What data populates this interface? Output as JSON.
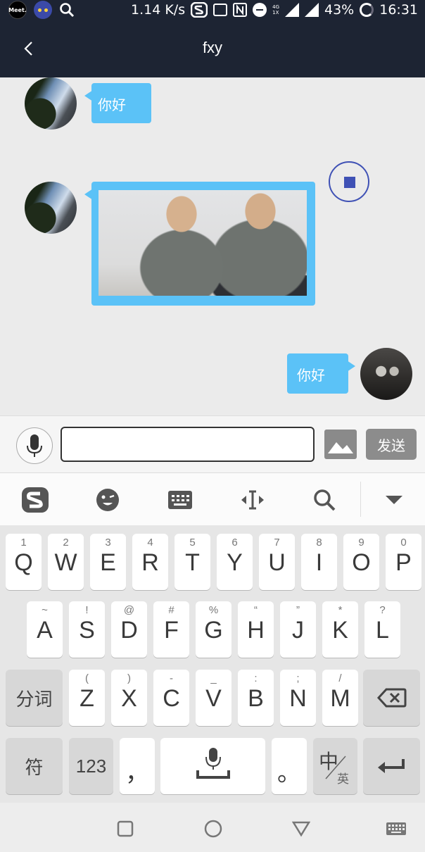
{
  "status_bar": {
    "app_badge": "Meet.",
    "network_speed": "1.14 K/s",
    "network_type_top": "4G",
    "network_type_bottom": "1X",
    "battery": "43%",
    "time": "16:31"
  },
  "header": {
    "title": "fxy"
  },
  "chat": {
    "messages": [
      {
        "side": "left",
        "type": "text",
        "text": "你好"
      },
      {
        "side": "left",
        "type": "image"
      },
      {
        "side": "right",
        "type": "text",
        "text": "你好"
      }
    ]
  },
  "input_bar": {
    "text_value": "",
    "send_label": "发送"
  },
  "keyboard": {
    "row1": [
      {
        "main": "Q",
        "sub": "1"
      },
      {
        "main": "W",
        "sub": "2"
      },
      {
        "main": "E",
        "sub": "3"
      },
      {
        "main": "R",
        "sub": "4"
      },
      {
        "main": "T",
        "sub": "5"
      },
      {
        "main": "Y",
        "sub": "6"
      },
      {
        "main": "U",
        "sub": "7"
      },
      {
        "main": "I",
        "sub": "8"
      },
      {
        "main": "O",
        "sub": "9"
      },
      {
        "main": "P",
        "sub": "0"
      }
    ],
    "row2": [
      {
        "main": "A",
        "sub": "~"
      },
      {
        "main": "S",
        "sub": "!"
      },
      {
        "main": "D",
        "sub": "@"
      },
      {
        "main": "F",
        "sub": "#"
      },
      {
        "main": "G",
        "sub": "%"
      },
      {
        "main": "H",
        "sub": "“"
      },
      {
        "main": "J",
        "sub": "”"
      },
      {
        "main": "K",
        "sub": "*"
      },
      {
        "main": "L",
        "sub": "?"
      }
    ],
    "row3": [
      {
        "main": "Z",
        "sub": "("
      },
      {
        "main": "X",
        "sub": ")"
      },
      {
        "main": "C",
        "sub": "-"
      },
      {
        "main": "V",
        "sub": "_"
      },
      {
        "main": "B",
        "sub": ":"
      },
      {
        "main": "N",
        "sub": ";"
      },
      {
        "main": "M",
        "sub": "/"
      }
    ],
    "segment_label": "分词",
    "symbol_label": "符",
    "numbers_label": "123",
    "comma_label": "，",
    "period_label": "。",
    "lang_main": "中",
    "lang_sub": "英"
  },
  "colors": {
    "header_bg": "#1d2433",
    "bubble": "#5bc2f7",
    "chat_bg": "#ebebeb",
    "stop_accent": "#3f51b5"
  }
}
